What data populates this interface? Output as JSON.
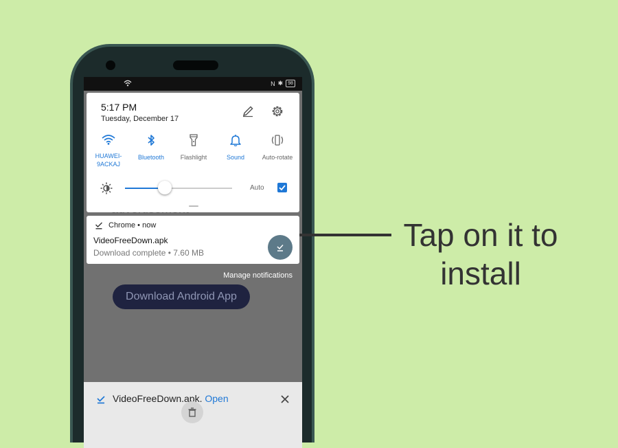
{
  "status_bar": {
    "battery": "98"
  },
  "quick_settings": {
    "time": "5:17 PM",
    "date": "Tuesday, December 17",
    "tiles": [
      {
        "label": "HUAWEI-9ACKAJ",
        "icon": "wifi-icon",
        "active": true
      },
      {
        "label": "Bluetooth",
        "icon": "bluetooth-icon",
        "active": true
      },
      {
        "label": "Flashlight",
        "icon": "flashlight-icon",
        "active": false
      },
      {
        "label": "Sound",
        "icon": "bell-icon",
        "active": true
      },
      {
        "label": "Auto-rotate",
        "icon": "auto-rotate-icon",
        "active": false
      }
    ],
    "brightness_level": 0.37,
    "auto_label": "Auto",
    "auto_checked": true
  },
  "notification": {
    "app_header": "Chrome • now",
    "title": "VideoFreeDown.apk",
    "body": "Download complete • 7.60 MB"
  },
  "manage_notifications": "Manage notifications",
  "background_page": {
    "partial_text": "advertisement",
    "button_label": "Download Android App"
  },
  "download_bar": {
    "filename": "VideoFreeDown.apk.",
    "open_label": "Open"
  },
  "callout": {
    "line1": "Tap on it to",
    "line2": "install"
  },
  "colors": {
    "background": "#cdeca8",
    "accent_blue": "#1f78d6",
    "phone_body": "#1c2b2b",
    "action_button": "#5d7a89"
  }
}
